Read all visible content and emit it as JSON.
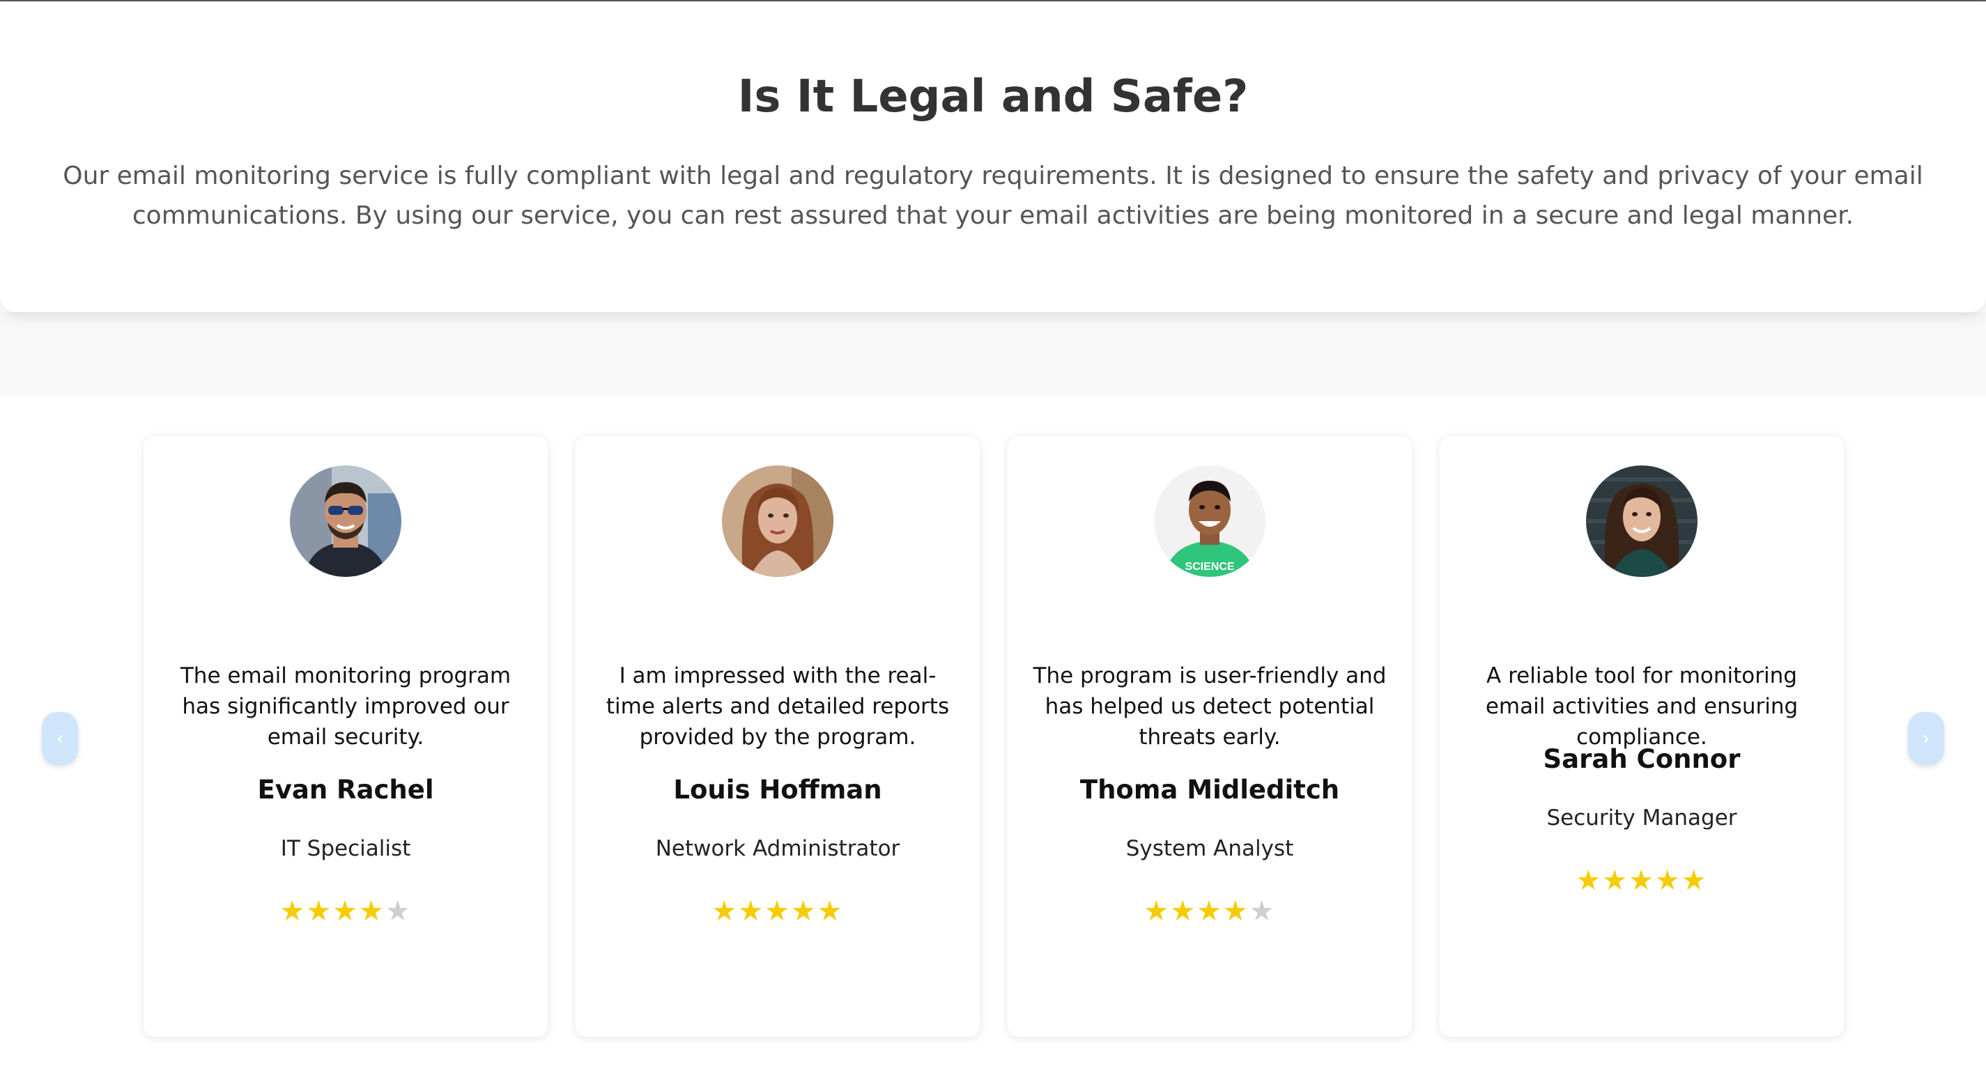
{
  "legal": {
    "title": "Is It Legal and Safe?",
    "body": "Our email monitoring service is fully compliant with legal and regulatory requirements. It is designed to ensure the safety and privacy of your email communications. By using our service, you can rest assured that your email activities are being monitored in a secure and legal manner."
  },
  "carousel": {
    "prev_icon": "‹",
    "next_icon": "›",
    "testimonials": [
      {
        "avatar": "person-sunglasses-icon",
        "quote": "The email monitoring program has significantly improved our email security.",
        "name": "Evan Rachel",
        "role": "IT Specialist",
        "rating": 4,
        "max_rating": 5
      },
      {
        "avatar": "person-long-hair-icon",
        "quote": "I am impressed with the real-time alerts and detailed reports provided by the program.",
        "name": "Louis Hoffman",
        "role": "Network Administrator",
        "rating": 5,
        "max_rating": 5
      },
      {
        "avatar": "person-green-shirt-icon",
        "quote": "The program is user-friendly and has helped us detect potential threats early.",
        "name": "Thoma Midleditch",
        "role": "System Analyst",
        "rating": 4,
        "max_rating": 5
      },
      {
        "avatar": "person-dark-hair-icon",
        "quote": "A reliable tool for monitoring email activities and ensuring compliance.",
        "name": "Sarah Connor",
        "role": "Security Manager",
        "rating": 5,
        "max_rating": 5
      }
    ]
  },
  "colors": {
    "star_filled": "#f5cc00",
    "star_empty": "#cfcfcf",
    "nav_button": "#cfe5fb"
  }
}
